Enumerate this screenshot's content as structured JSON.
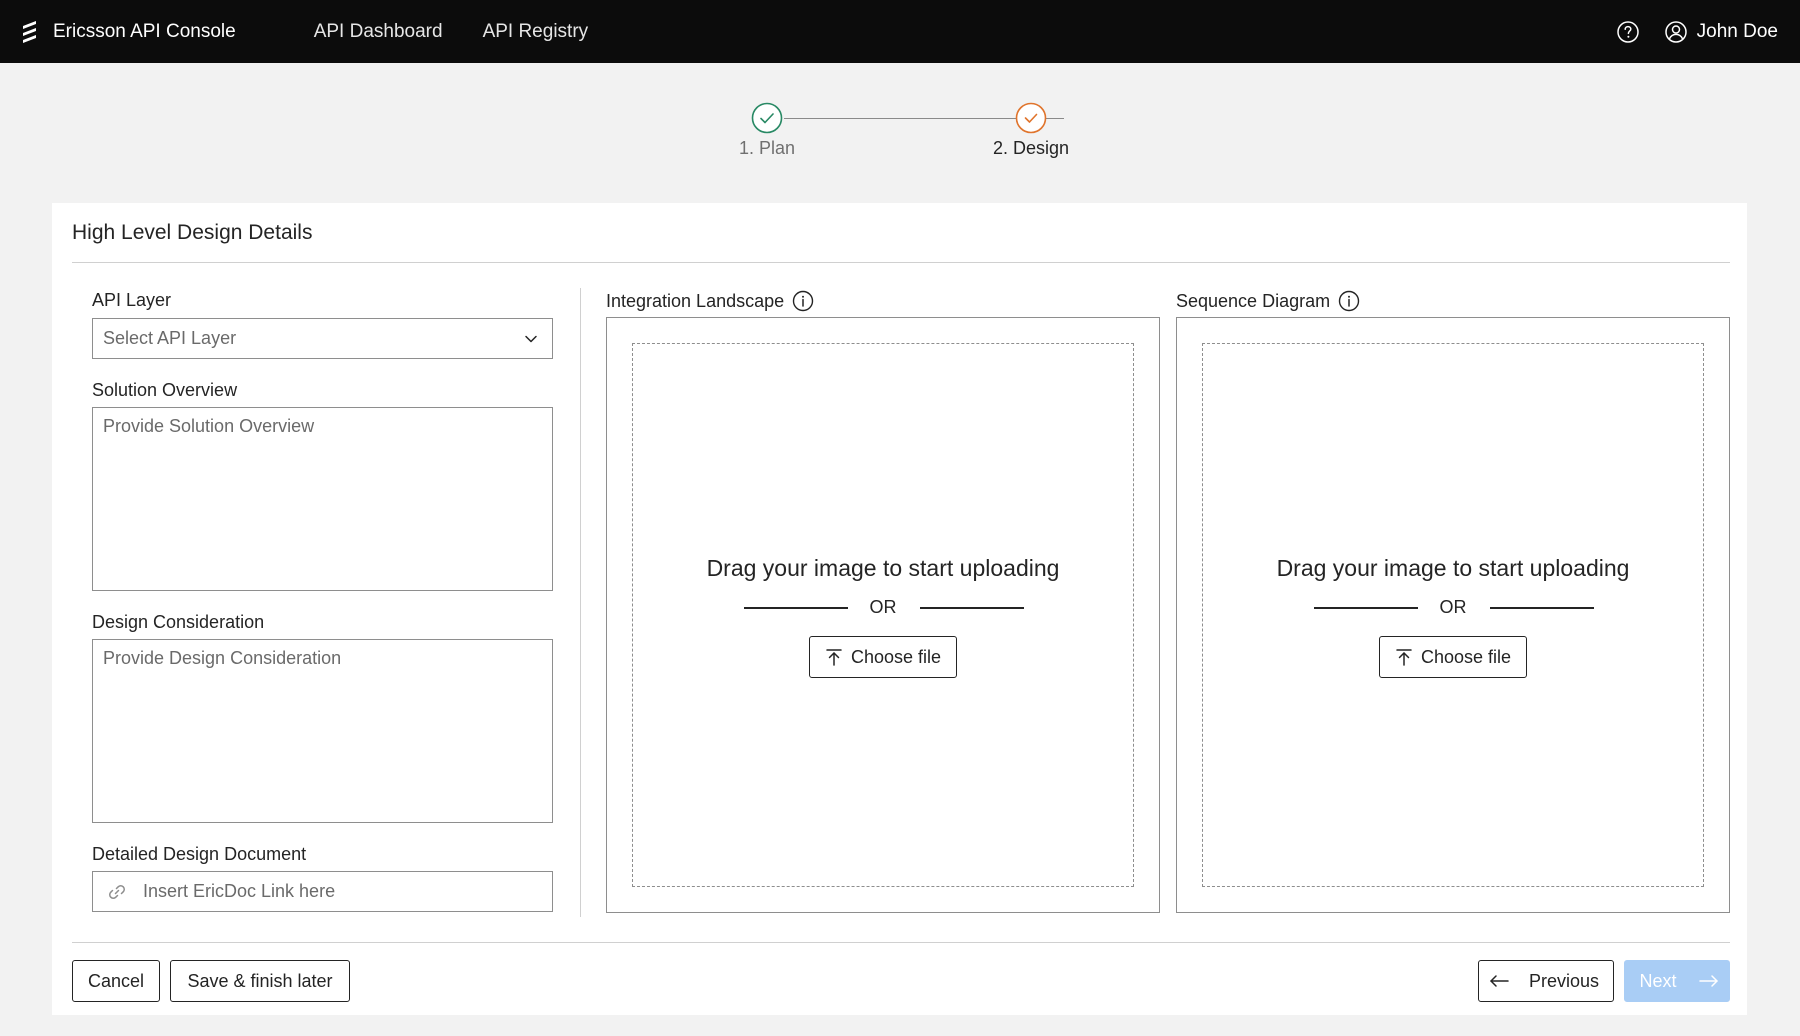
{
  "header": {
    "app_name": "Ericsson API Console",
    "nav": [
      {
        "label": "API Dashboard"
      },
      {
        "label": "API Registry"
      }
    ],
    "user_name": "John Doe",
    "icons": {
      "logo": "ericsson-logo",
      "help": "help-icon",
      "user": "user-icon"
    }
  },
  "stepper": {
    "steps": [
      {
        "label": "1. Plan",
        "status": "completed",
        "color": "#288964"
      },
      {
        "label": "2. Design",
        "status": "current",
        "color": "#e0742c"
      }
    ]
  },
  "form": {
    "title": "High Level Design Details",
    "api_layer": {
      "label": "API Layer",
      "placeholder": "Select API Layer"
    },
    "solution_overview": {
      "label": "Solution Overview",
      "placeholder": "Provide Solution Overview"
    },
    "design_consideration": {
      "label": "Design Consideration",
      "placeholder": "Provide Design Consideration"
    },
    "detailed_design_document": {
      "label": "Detailed Design Document",
      "placeholder": "Insert EricDoc Link here"
    }
  },
  "uploads": [
    {
      "label": "Integration Landscape",
      "drop_text": "Drag your image to start uploading",
      "or_text": "OR",
      "button_label": "Choose file"
    },
    {
      "label": "Sequence Diagram",
      "drop_text": "Drag your image to start uploading",
      "or_text": "OR",
      "button_label": "Choose file"
    }
  ],
  "footer": {
    "cancel_label": "Cancel",
    "save_label": "Save & finish later",
    "previous_label": "Previous",
    "next_label": "Next"
  },
  "colors": {
    "topbar": "#0c0c0c",
    "background": "#f2f2f2",
    "next_disabled": "#a9cdf5"
  }
}
